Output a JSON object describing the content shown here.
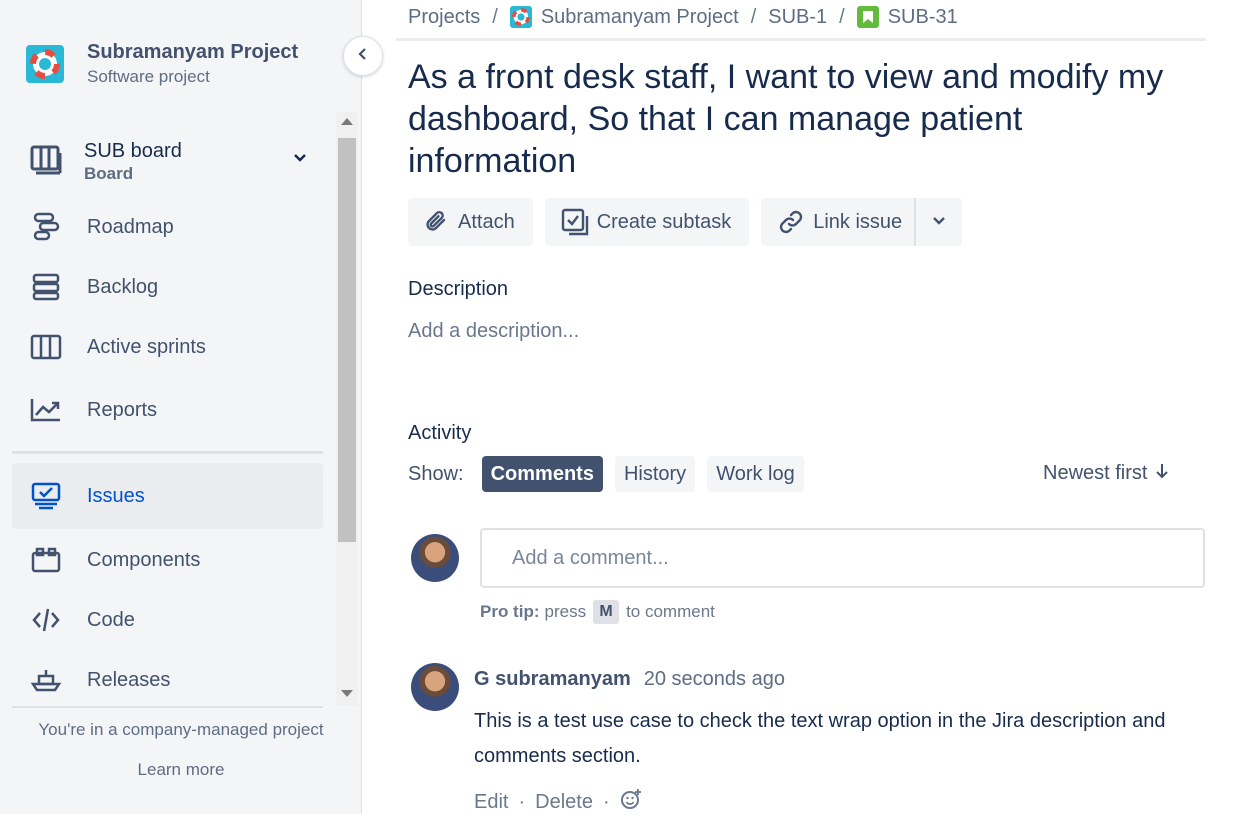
{
  "sidebar": {
    "project_name": "Subramanyam Project",
    "project_type": "Software project",
    "board": {
      "name": "SUB board",
      "sub": "Board"
    },
    "items": [
      {
        "label": "Roadmap",
        "icon": "roadmap-icon"
      },
      {
        "label": "Backlog",
        "icon": "backlog-icon"
      },
      {
        "label": "Active sprints",
        "icon": "active-sprints-icon"
      },
      {
        "label": "Reports",
        "icon": "reports-icon"
      },
      {
        "label": "Issues",
        "icon": "issues-icon",
        "selected": true
      },
      {
        "label": "Components",
        "icon": "components-icon"
      },
      {
        "label": "Code",
        "icon": "code-icon"
      },
      {
        "label": "Releases",
        "icon": "releases-icon"
      }
    ],
    "footer_text": "You're in a company-managed project",
    "footer_link": "Learn more"
  },
  "breadcrumbs": {
    "projects": "Projects",
    "project": "Subramanyam Project",
    "parent": "SUB-1",
    "issue": "SUB-31",
    "separator": "/"
  },
  "issue": {
    "title": "As a front desk staff, I want to view and modify my dashboard, So that I can manage patient information"
  },
  "toolbar": {
    "attach": "Attach",
    "create_subtask": "Create subtask",
    "link_issue": "Link issue"
  },
  "description": {
    "label": "Description",
    "placeholder": "Add a description..."
  },
  "activity": {
    "label": "Activity",
    "show_label": "Show:",
    "tabs": [
      "Comments",
      "History",
      "Work log"
    ],
    "active_tab": "Comments",
    "sort": "Newest first"
  },
  "comment_input": {
    "placeholder": "Add a comment...",
    "protip_label": "Pro tip:",
    "protip_press": "press",
    "protip_key": "M",
    "protip_rest": "to comment"
  },
  "comments": [
    {
      "author": "G subramanyam",
      "time": "20 seconds ago",
      "body": "This is a test use case to check the text wrap option in the Jira description and comments section.",
      "edit": "Edit",
      "delete": "Delete"
    }
  ],
  "colors": {
    "accent": "#0052cc",
    "sidebar_bg": "#f4f5f7",
    "project_avatar": "#29b8d6",
    "story_icon": "#63ba3c",
    "chip_active": "#42526e"
  }
}
